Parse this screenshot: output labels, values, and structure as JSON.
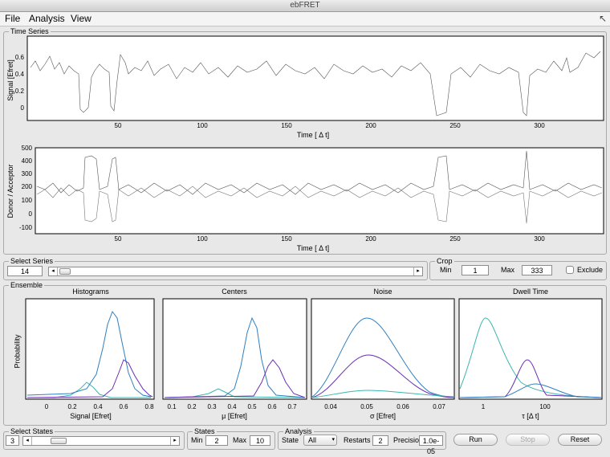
{
  "window": {
    "title": "ebFRET"
  },
  "menu": {
    "file": "File",
    "analysis": "Analysis",
    "view": "View",
    "resize_glyph": "↖"
  },
  "time_series": {
    "title": "Time Series",
    "fret_plot": {
      "ylabel": "Signal [Efret]",
      "xlabel": "Time [ Δ t]",
      "yticks": [
        "0.6",
        "0.4",
        "0.2",
        "0"
      ],
      "xticks": [
        "50",
        "100",
        "150",
        "200",
        "250",
        "300"
      ]
    },
    "da_plot": {
      "ylabel": "Donor / Acceptor",
      "xlabel": "Time [ Δ t]",
      "yticks": [
        "500",
        "400",
        "300",
        "200",
        "100",
        "0",
        "-100"
      ],
      "xticks": [
        "50",
        "100",
        "150",
        "200",
        "250",
        "300"
      ]
    }
  },
  "select_series": {
    "title": "Select Series",
    "value": "14"
  },
  "crop": {
    "title": "Crop",
    "min_label": "Min",
    "min_value": "1",
    "max_label": "Max",
    "max_value": "333",
    "exclude_label": "Exclude",
    "exclude_checked": false
  },
  "ensemble": {
    "title": "Ensemble",
    "ylabel": "Probability",
    "histograms": {
      "title": "Histograms",
      "xlabel": "Signal [Efret]",
      "xticks": [
        "0",
        "0.2",
        "0.4",
        "0.6",
        "0.8"
      ]
    },
    "centers": {
      "title": "Centers",
      "xlabel": "μ [Efret]",
      "xticks": [
        "0.1",
        "0.2",
        "0.3",
        "0.4",
        "0.5",
        "0.6",
        "0.7"
      ]
    },
    "noise": {
      "title": "Noise",
      "xlabel": "σ [Efret]",
      "xticks": [
        "0.04",
        "0.05",
        "0.06",
        "0.07"
      ]
    },
    "dwell": {
      "title": "Dwell Time",
      "xlabel": "τ [Δ t]",
      "xticks": [
        "1",
        "100"
      ]
    }
  },
  "select_states": {
    "title": "Select States",
    "value": "3"
  },
  "states": {
    "title": "States",
    "min_label": "Min",
    "min_value": "2",
    "max_label": "Max",
    "max_value": "10"
  },
  "analysis": {
    "title": "Analysis",
    "state_label": "State",
    "state_value": "All",
    "restarts_label": "Restarts",
    "restarts_value": "2",
    "precision_label": "Precisio",
    "precision_value": "1.0e-05",
    "run_label": "Run",
    "stop_label": "Stop",
    "reset_label": "Reset"
  },
  "colors": {
    "state_blue": "#2f7fc0",
    "state_cyan": "#3bb5b0",
    "state_purple": "#6a2fb5",
    "fit_red": "#d03020",
    "fit_green": "#25a040",
    "raw_gray": "#555555"
  }
}
